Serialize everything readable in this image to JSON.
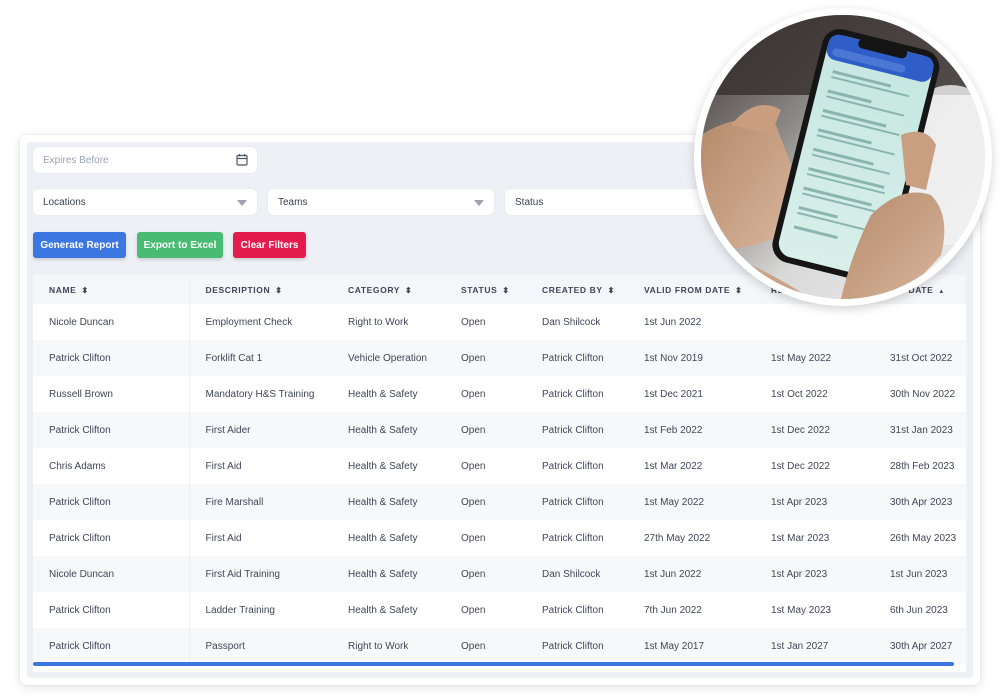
{
  "filters": {
    "expires_before": {
      "placeholder": "Expires Before",
      "icon": "calendar-icon"
    },
    "locations": {
      "selected": "Locations"
    },
    "teams": {
      "selected": "Teams"
    },
    "status": {
      "selected": "Status"
    }
  },
  "actions": {
    "generate_report": "Generate Report",
    "export_excel": "Export to Excel",
    "clear_filters": "Clear Filters"
  },
  "colors": {
    "primary": "#3b76e1",
    "success": "#49bb73",
    "danger": "#e31b4f",
    "panel": "#edf1f6"
  },
  "table": {
    "columns": [
      {
        "label": "NAME",
        "sort": "unsorted"
      },
      {
        "label": "DESCRIPTION",
        "sort": "unsorted"
      },
      {
        "label": "CATEGORY",
        "sort": "unsorted"
      },
      {
        "label": "STATUS",
        "sort": "unsorted"
      },
      {
        "label": "CREATED BY",
        "sort": "unsorted"
      },
      {
        "label": "VALID FROM DATE",
        "sort": "unsorted"
      },
      {
        "label": "RE",
        "sort": ""
      },
      {
        "label": "IRY DATE",
        "sort": "ascending"
      }
    ],
    "rows": [
      {
        "name": "Nicole Duncan",
        "description": "Employment Check",
        "category": "Right to Work",
        "status": "Open",
        "created_by": "Dan Shilcock",
        "valid_from": "1st Jun 2022",
        "renewal": "",
        "expiry": ""
      },
      {
        "name": "Patrick Clifton",
        "description": "Forklift Cat 1",
        "category": "Vehicle Operation",
        "status": "Open",
        "created_by": "Patrick Clifton",
        "valid_from": "1st Nov 2019",
        "renewal": "1st May 2022",
        "expiry": "31st Oct 2022"
      },
      {
        "name": "Russell Brown",
        "description": "Mandatory H&S Training",
        "category": "Health & Safety",
        "status": "Open",
        "created_by": "Patrick Clifton",
        "valid_from": "1st Dec 2021",
        "renewal": "1st Oct 2022",
        "expiry": "30th Nov 2022"
      },
      {
        "name": "Patrick Clifton",
        "description": "First Aider",
        "category": "Health & Safety",
        "status": "Open",
        "created_by": "Patrick Clifton",
        "valid_from": "1st Feb 2022",
        "renewal": "1st Dec 2022",
        "expiry": "31st Jan 2023"
      },
      {
        "name": "Chris Adams",
        "description": "First Aid",
        "category": "Health & Safety",
        "status": "Open",
        "created_by": "Patrick Clifton",
        "valid_from": "1st Mar 2022",
        "renewal": "1st Dec 2022",
        "expiry": "28th Feb 2023"
      },
      {
        "name": "Patrick Clifton",
        "description": "Fire Marshall",
        "category": "Health & Safety",
        "status": "Open",
        "created_by": "Patrick Clifton",
        "valid_from": "1st May 2022",
        "renewal": "1st Apr 2023",
        "expiry": "30th Apr 2023"
      },
      {
        "name": "Patrick Clifton",
        "description": "First Aid",
        "category": "Health & Safety",
        "status": "Open",
        "created_by": "Patrick Clifton",
        "valid_from": "27th May 2022",
        "renewal": "1st Mar 2023",
        "expiry": "26th May 2023"
      },
      {
        "name": "Nicole Duncan",
        "description": "First Aid Training",
        "category": "Health & Safety",
        "status": "Open",
        "created_by": "Dan Shilcock",
        "valid_from": "1st Jun 2022",
        "renewal": "1st Apr 2023",
        "expiry": "1st Jun 2023"
      },
      {
        "name": "Patrick Clifton",
        "description": "Ladder Training",
        "category": "Health & Safety",
        "status": "Open",
        "created_by": "Patrick Clifton",
        "valid_from": "7th Jun 2022",
        "renewal": "1st May 2023",
        "expiry": "6th Jun 2023"
      },
      {
        "name": "Patrick Clifton",
        "description": "Passport",
        "category": "Right to Work",
        "status": "Open",
        "created_by": "Patrick Clifton",
        "valid_from": "1st May 2017",
        "renewal": "1st Jan 2027",
        "expiry": "30th Apr 2027"
      }
    ]
  },
  "overlay": {
    "image": "hands-holding-smartphone-photo"
  }
}
